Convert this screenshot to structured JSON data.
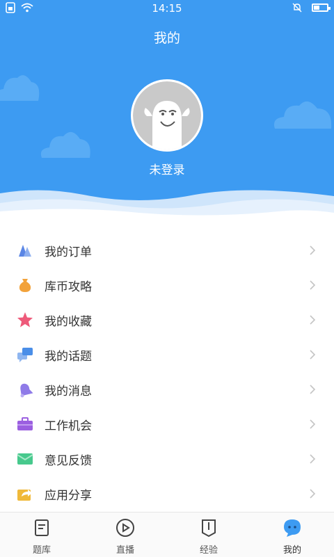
{
  "status_bar": {
    "time": "14:15",
    "icons": [
      "sim-icon",
      "wifi-icon",
      "bell-off-icon",
      "battery-icon"
    ]
  },
  "header": {
    "title": "我的",
    "login_text": "未登录",
    "background_color": "#3d9bf2"
  },
  "menu": {
    "items": [
      {
        "label": "我的订单",
        "icon": "order-icon",
        "color": "#5b86e5"
      },
      {
        "label": "库币攻略",
        "icon": "money-bag-icon",
        "color": "#f2a23a"
      },
      {
        "label": "我的收藏",
        "icon": "star-icon",
        "color": "#ee5a7a"
      },
      {
        "label": "我的话题",
        "icon": "chat-bubbles-icon",
        "color": "#4a8ee8"
      },
      {
        "label": "我的消息",
        "icon": "bell-icon",
        "color": "#8f7be8"
      },
      {
        "label": "工作机会",
        "icon": "briefcase-icon",
        "color": "#9b5fe0"
      },
      {
        "label": "意见反馈",
        "icon": "mail-icon",
        "color": "#47c98d"
      },
      {
        "label": "应用分享",
        "icon": "share-icon",
        "color": "#f0b93a"
      }
    ]
  },
  "tabbar": {
    "tabs": [
      {
        "label": "题库",
        "icon": "question-bank-icon"
      },
      {
        "label": "直播",
        "icon": "play-icon"
      },
      {
        "label": "经验",
        "icon": "bookmark-icon"
      },
      {
        "label": "我的",
        "icon": "profile-chat-icon",
        "active": true
      }
    ]
  }
}
